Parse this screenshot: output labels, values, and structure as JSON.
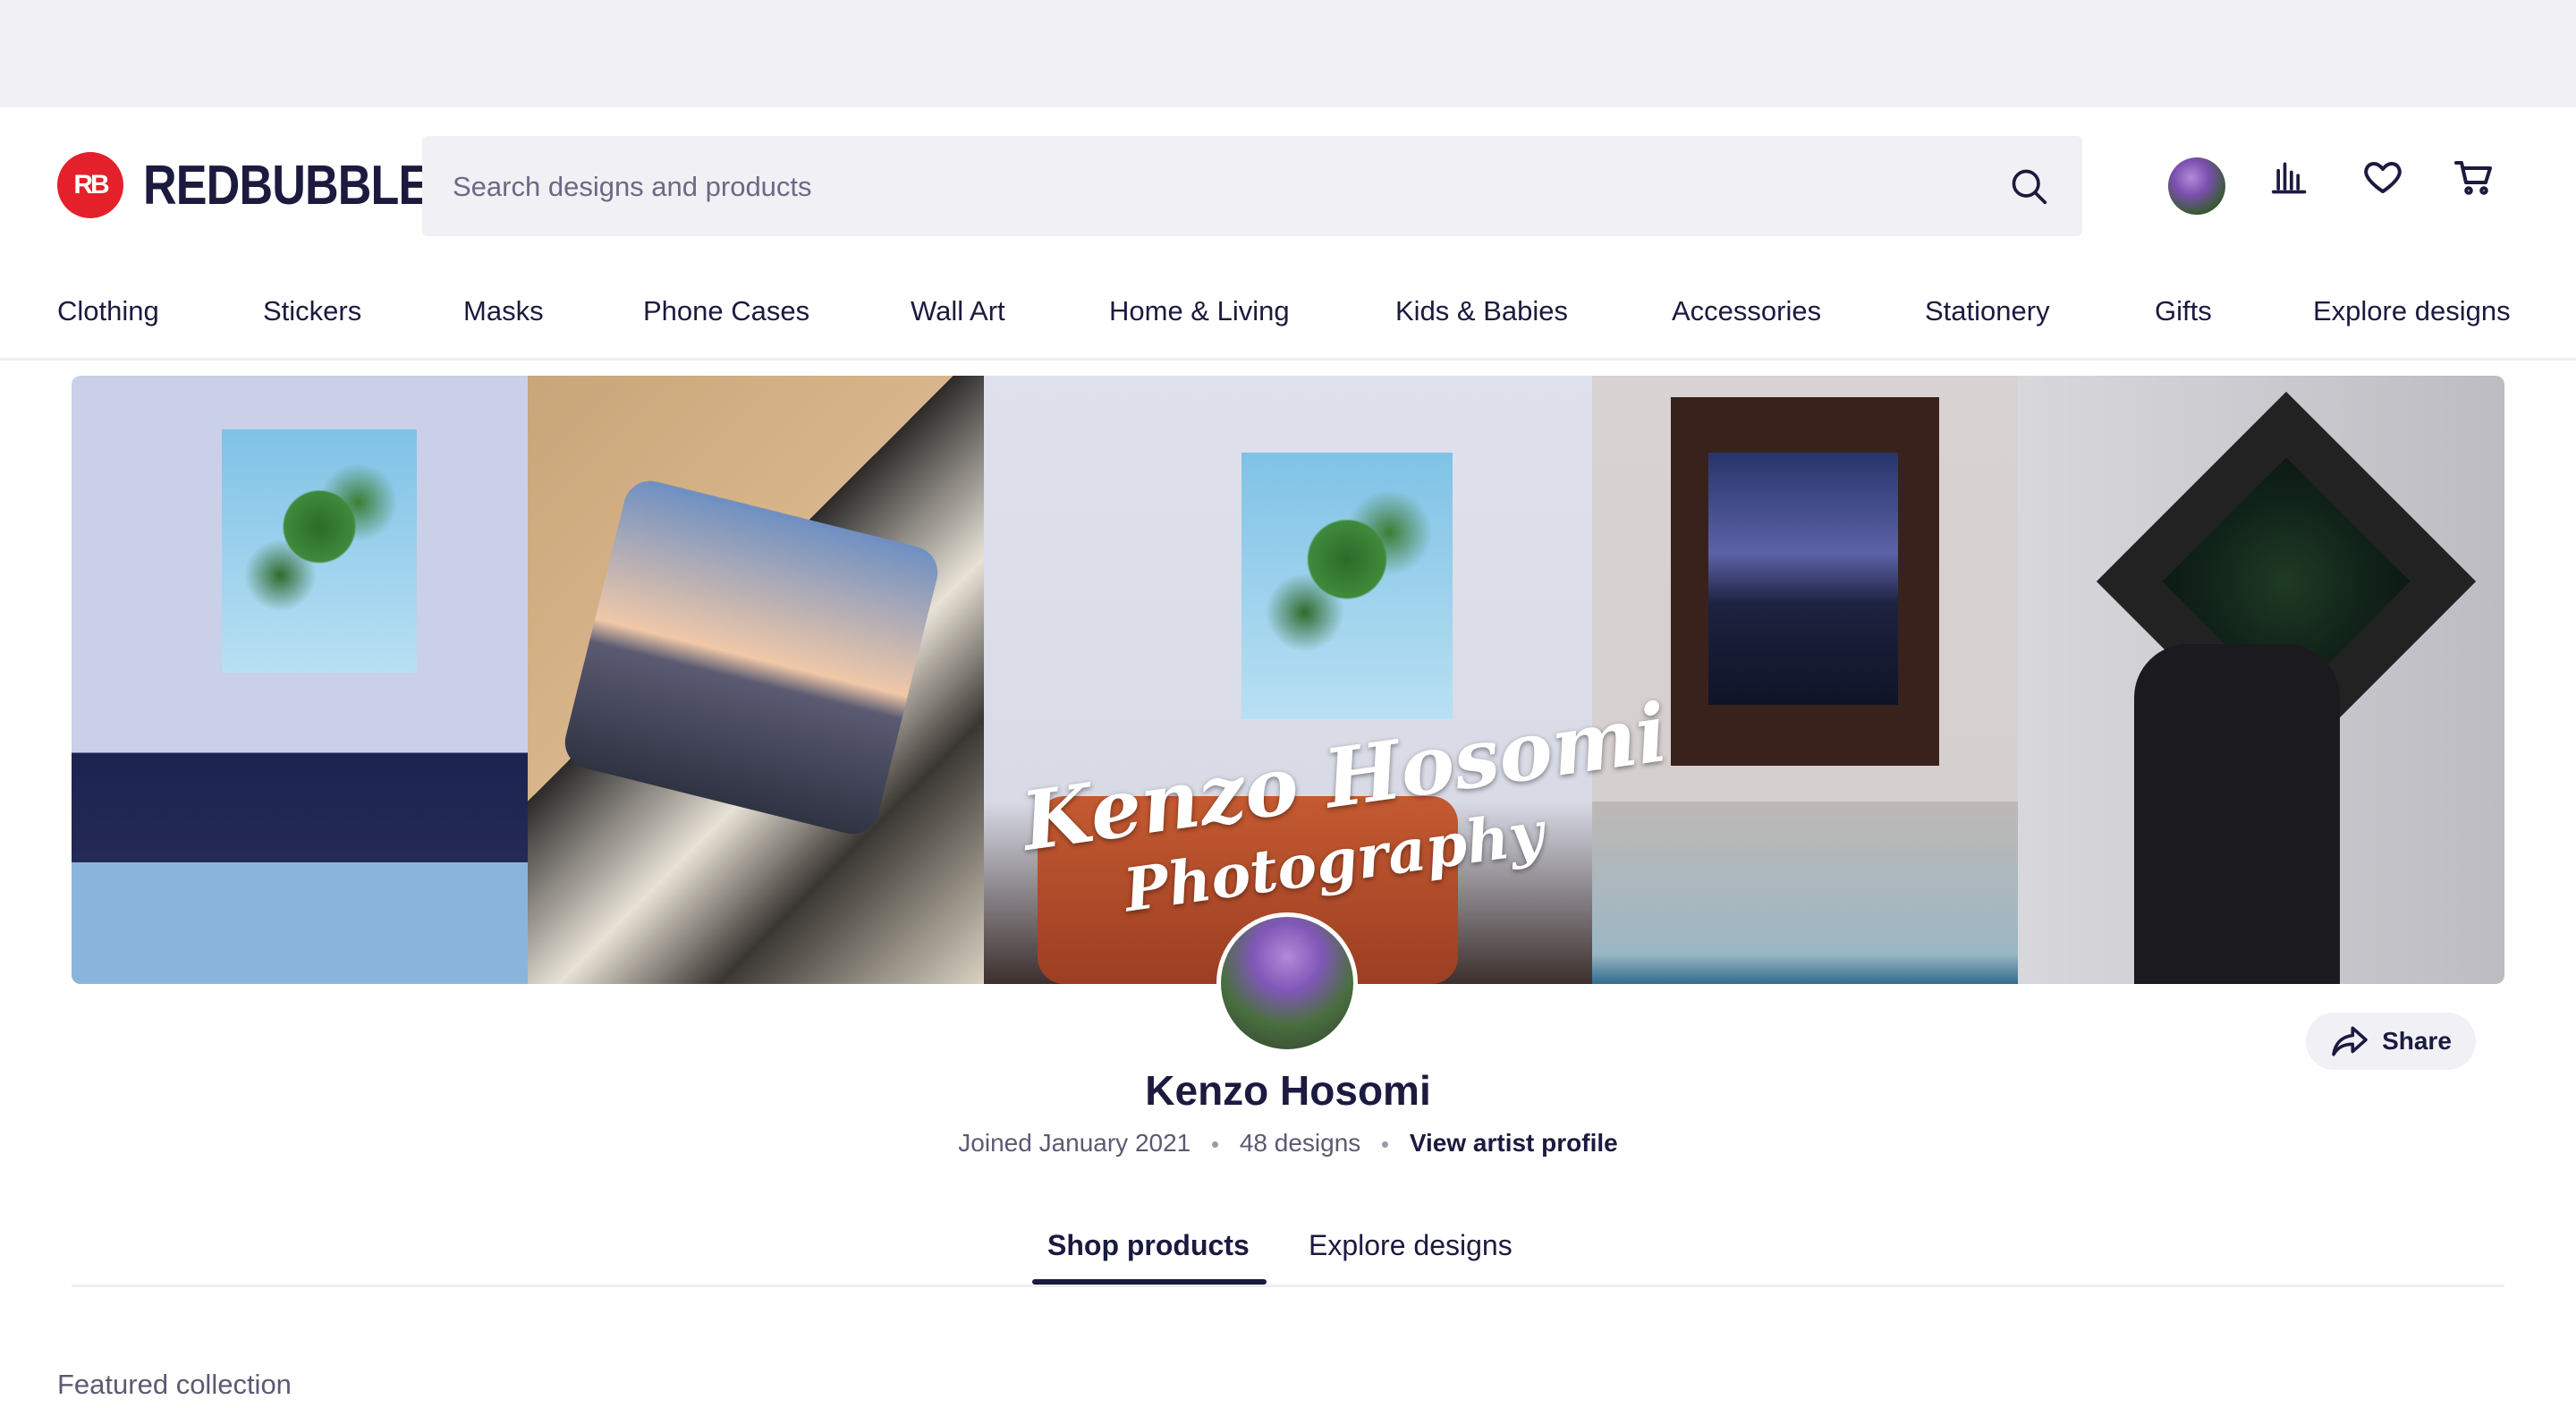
{
  "header": {
    "logo_text": "REDBUBBLE",
    "logo_mark": "RB",
    "search_placeholder": "Search designs and products",
    "icons": [
      "search-icon",
      "avatar",
      "stats-icon",
      "heart-icon",
      "cart-icon"
    ]
  },
  "nav": {
    "items": [
      "Clothing",
      "Stickers",
      "Masks",
      "Phone Cases",
      "Wall Art",
      "Home & Living",
      "Kids & Babies",
      "Accessories",
      "Stationery",
      "Gifts",
      "Explore designs"
    ]
  },
  "banner": {
    "title_line1": "Kenzo Hosomi",
    "title_line2": "Photography"
  },
  "profile": {
    "name": "Kenzo Hosomi",
    "joined": "Joined January 2021",
    "designs": "48 designs",
    "artist_link": "View artist profile",
    "share_label": "Share"
  },
  "tabs": {
    "items": [
      "Shop products",
      "Explore designs"
    ],
    "active": "Shop products"
  },
  "section": {
    "featured_label": "Featured collection"
  },
  "colors": {
    "brand_red": "#e4202a",
    "text_dark": "#1b1a3f",
    "surface": "#f1f0f5"
  }
}
